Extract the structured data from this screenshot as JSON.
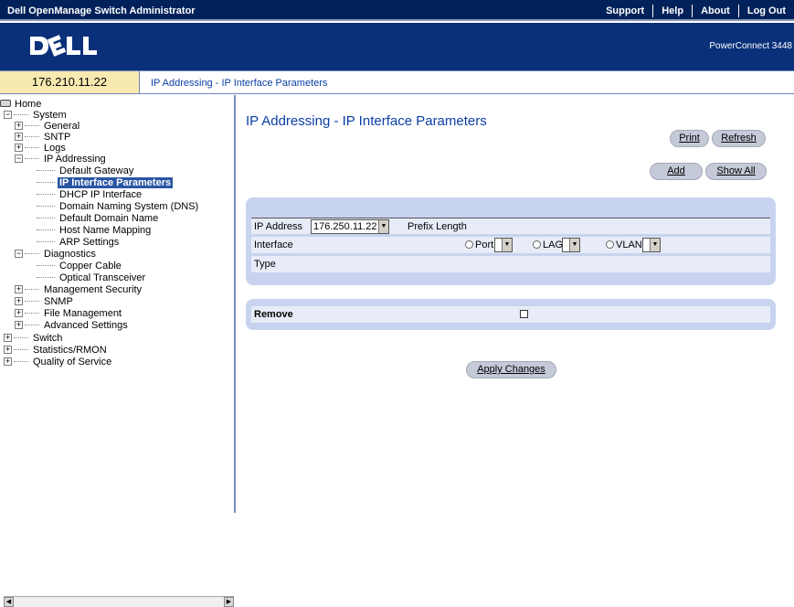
{
  "app": {
    "title": "Dell OpenManage Switch Administrator",
    "links": [
      "Support",
      "Help",
      "About",
      "Log Out"
    ],
    "model": "PowerConnect 3448"
  },
  "header": {
    "ip": "176.210.11.22",
    "breadcrumb": "IP Addressing - IP Interface Parameters"
  },
  "tree": [
    {
      "label": "Home",
      "icon": "home-icon"
    },
    {
      "label": "System",
      "expander": "−"
    },
    {
      "label": "General",
      "expander": "+"
    },
    {
      "label": "SNTP",
      "expander": "+"
    },
    {
      "label": "Logs",
      "expander": "+"
    },
    {
      "label": "IP Addressing",
      "expander": "−"
    },
    {
      "label": "Default Gateway"
    },
    {
      "label": "IP Interface Parameters",
      "selected": true
    },
    {
      "label": "DHCP IP Interface"
    },
    {
      "label": "Domain Naming System (DNS)"
    },
    {
      "label": "Default Domain Name"
    },
    {
      "label": "Host Name Mapping"
    },
    {
      "label": "ARP Settings"
    },
    {
      "label": "Diagnostics",
      "expander": "−"
    },
    {
      "label": "Copper Cable"
    },
    {
      "label": "Optical Transceiver"
    },
    {
      "label": "Management Security",
      "expander": "+"
    },
    {
      "label": "SNMP",
      "expander": "+"
    },
    {
      "label": "File Management",
      "expander": "+"
    },
    {
      "label": "Advanced Settings",
      "expander": "+"
    },
    {
      "label": "Switch",
      "expander": "+"
    },
    {
      "label": "Statistics/RMON",
      "expander": "+"
    },
    {
      "label": "Quality of Service",
      "expander": "+"
    }
  ],
  "main": {
    "title": "IP Addressing - IP Interface Parameters",
    "buttons": {
      "print": "Print",
      "refresh": "Refresh",
      "add": "Add",
      "show_all": "Show All",
      "apply": "Apply Changes"
    },
    "form": {
      "ip_address_label": "IP Address",
      "ip_address_value": "176.250.11.22",
      "prefix_length_label": "Prefix Length",
      "interface_label": "Interface",
      "port_label": "Port",
      "lag_label": "LAG",
      "vlan_label": "VLAN",
      "type_label": "Type",
      "remove_label": "Remove"
    }
  }
}
